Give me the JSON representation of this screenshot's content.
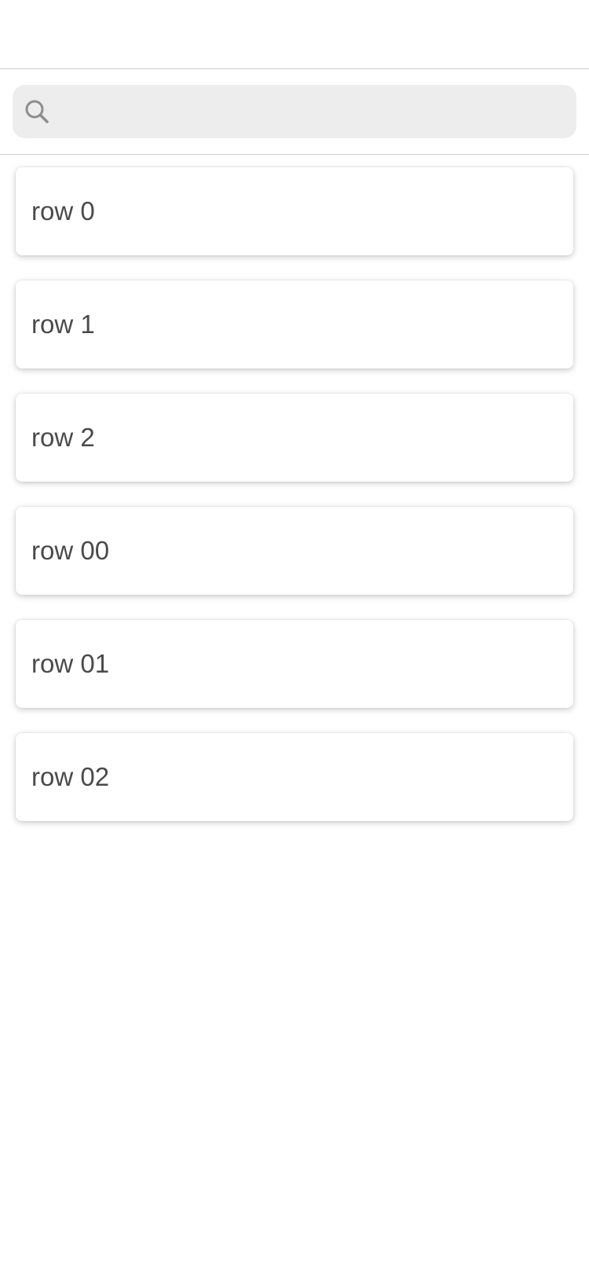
{
  "search": {
    "placeholder": "",
    "value": "",
    "icon": "search-icon"
  },
  "rows": [
    {
      "label": "row 0"
    },
    {
      "label": "row 1"
    },
    {
      "label": "row 2"
    },
    {
      "label": "row 00"
    },
    {
      "label": "row 01"
    },
    {
      "label": "row 02"
    }
  ],
  "colors": {
    "search_background": "#ededed",
    "divider": "#cfcfcf",
    "row_text": "#4a4a4a"
  }
}
